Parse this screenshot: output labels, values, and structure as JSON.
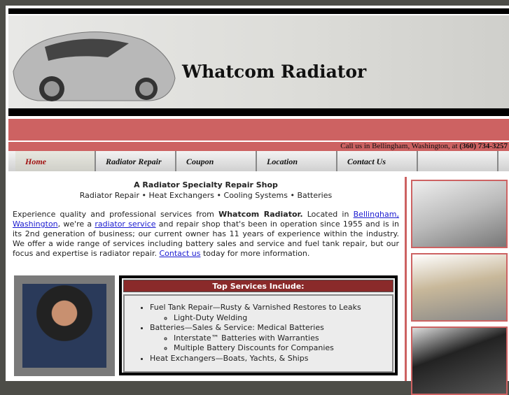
{
  "header": {
    "title": "Whatcom Radiator",
    "call_prefix": "Call us in Bellingham, Washington, at ",
    "phone": "(360) 734-3257"
  },
  "nav": [
    {
      "label": "Home"
    },
    {
      "label": "Radiator Repair"
    },
    {
      "label": "Coupon"
    },
    {
      "label": "Location"
    },
    {
      "label": "Contact Us"
    }
  ],
  "main": {
    "heading": "A Radiator Specialty Repair Shop",
    "subheading": "Radiator Repair • Heat Exchangers • Cooling Systems • Batteries",
    "intro": {
      "p1": "Experience quality and professional services from ",
      "company": "Whatcom Radiator.",
      "p2": " Located in ",
      "link_location": "Bellingham, Washington",
      "p3": ", we're a ",
      "link_service": "radiator service",
      "p4": " and repair shop that's been in operation since 1955 and is in its 2nd generation of business; our current owner has 11 years of experience within the industry. We offer a wide range of services including battery sales and service and fuel tank repair, but our focus and expertise is radiator repair. ",
      "link_contact": "Contact us",
      "p5": " today for more information."
    },
    "services": {
      "title": "Top Services Include:",
      "items": [
        {
          "label": "Fuel Tank Repair—Rusty & Varnished Restores to Leaks",
          "sub": [
            "Light-Duty Welding"
          ]
        },
        {
          "label": "Batteries—Sales & Service: Medical Batteries",
          "sub": [
            "Interstate™ Batteries with Warranties",
            "Multiple Battery Discounts for Companies"
          ]
        },
        {
          "label": "Heat Exchangers—Boats, Yachts, & Ships",
          "sub": []
        }
      ]
    }
  }
}
